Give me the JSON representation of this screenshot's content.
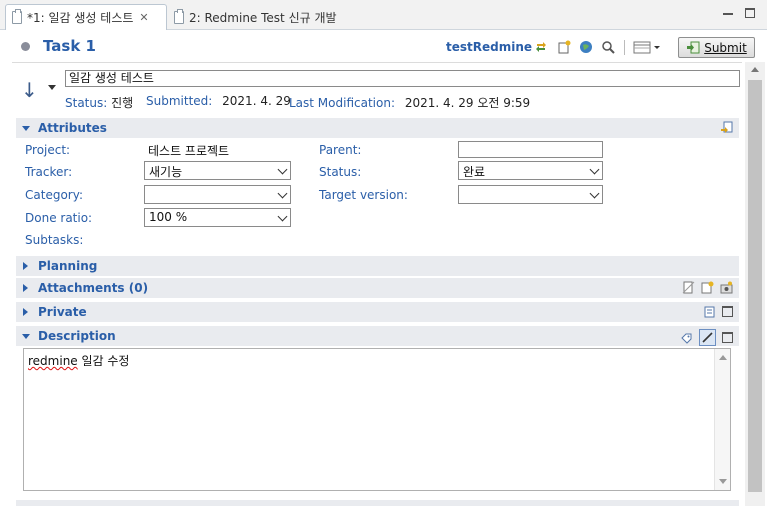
{
  "tabs": [
    {
      "label": "*1: 일감 생성 테스트"
    },
    {
      "label": "2: Redmine Test 신규 개발"
    }
  ],
  "header": {
    "title": "Task 1",
    "repository": "testRedmine",
    "submit_label": "Submit"
  },
  "summary": {
    "value": "일감 생성 테스트",
    "status_label": "Status:",
    "status_value": "진행",
    "submitted_label": "Submitted:",
    "submitted_value": "2021. 4. 29",
    "modified_label": "Last Modification:",
    "modified_value": "2021. 4. 29 오전 9:59"
  },
  "sections": {
    "attributes": "Attributes",
    "planning": "Planning",
    "attachments": "Attachments (0)",
    "private": "Private",
    "description": "Description"
  },
  "attributes": {
    "project_label": "Project:",
    "project_value": "테스트 프로젝트",
    "tracker_label": "Tracker:",
    "tracker_value": "새기능",
    "category_label": "Category:",
    "category_value": "",
    "done_label": "Done ratio:",
    "done_value": "100 %",
    "subtasks_label": "Subtasks:",
    "parent_label": "Parent:",
    "parent_value": "",
    "status_label": "Status:",
    "status_value": "완료",
    "target_label": "Target version:",
    "target_value": ""
  },
  "description": {
    "text_word": "redmine",
    "text_rest": " 일감 수정"
  },
  "icons": {
    "tab_close": "✕",
    "section_colors": {
      "header_bg": "#e9ebef",
      "title": "#2a5ea8"
    }
  }
}
